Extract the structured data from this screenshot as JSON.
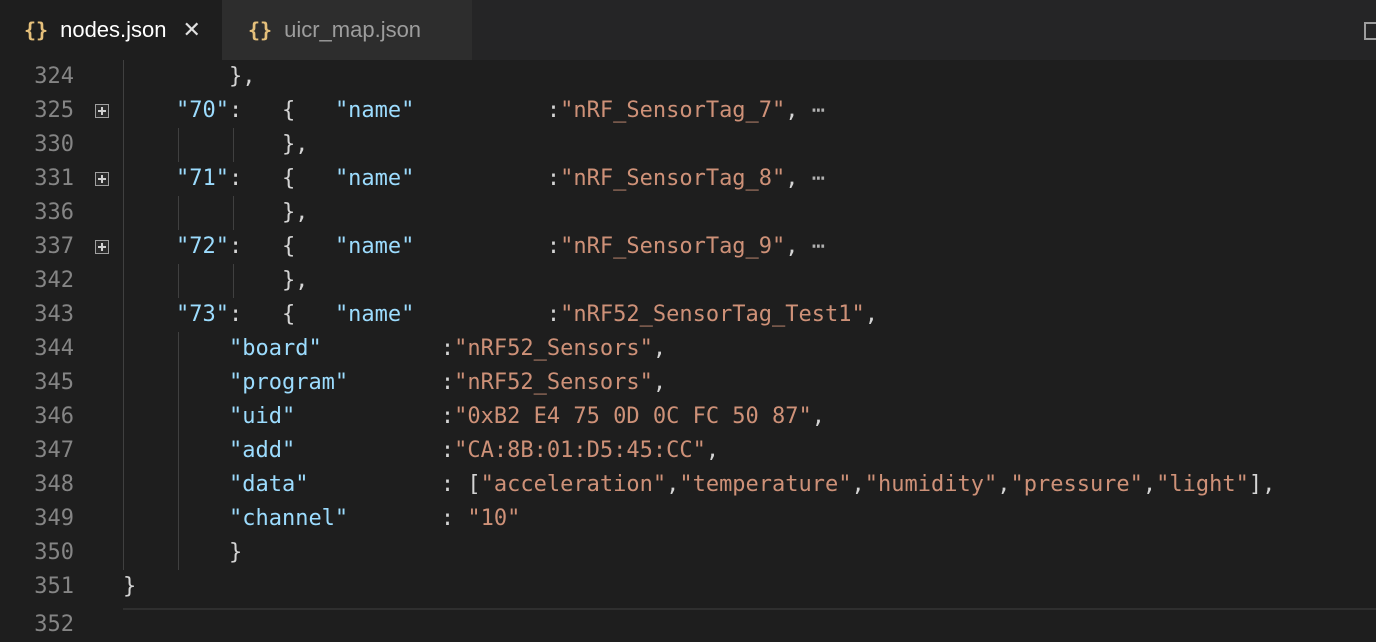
{
  "tabs": [
    {
      "label": "nodes.json",
      "icon": "{}",
      "close": "✕"
    },
    {
      "label": "uicr_map.json",
      "icon": "{}"
    }
  ],
  "lines": [
    {
      "n": "324",
      "code": "        },"
    },
    {
      "n": "325",
      "code": "    \"70\":   {   \"name\"          :\"nRF_SensorTag_7\",",
      "ellipsis": " ⋯"
    },
    {
      "n": "330",
      "code": "            },"
    },
    {
      "n": "331",
      "code": "    \"71\":   {   \"name\"          :\"nRF_SensorTag_8\",",
      "ellipsis": " ⋯"
    },
    {
      "n": "336",
      "code": "            },"
    },
    {
      "n": "337",
      "code": "    \"72\":   {   \"name\"          :\"nRF_SensorTag_9\",",
      "ellipsis": " ⋯"
    },
    {
      "n": "342",
      "code": "            },"
    },
    {
      "n": "343",
      "code": "    \"73\":   {   \"name\"          :\"nRF52_SensorTag_Test1\","
    },
    {
      "n": "344",
      "code": "        \"board\"         :\"nRF52_Sensors\","
    },
    {
      "n": "345",
      "code": "        \"program\"       :\"nRF52_Sensors\","
    },
    {
      "n": "346",
      "code": "        \"uid\"           :\"0xB2 E4 75 0D 0C FC 50 87\","
    },
    {
      "n": "347",
      "code": "        \"add\"           :\"CA:8B:01:D5:45:CC\","
    },
    {
      "n": "348",
      "code": "        \"data\"          : [\"acceleration\",\"temperature\",\"humidity\",\"pressure\",\"light\"],"
    },
    {
      "n": "349",
      "code": "        \"channel\"       : \"10\""
    },
    {
      "n": "350",
      "code": "        }"
    },
    {
      "n": "351",
      "code": "}"
    },
    {
      "n": "352",
      "code": ""
    }
  ]
}
